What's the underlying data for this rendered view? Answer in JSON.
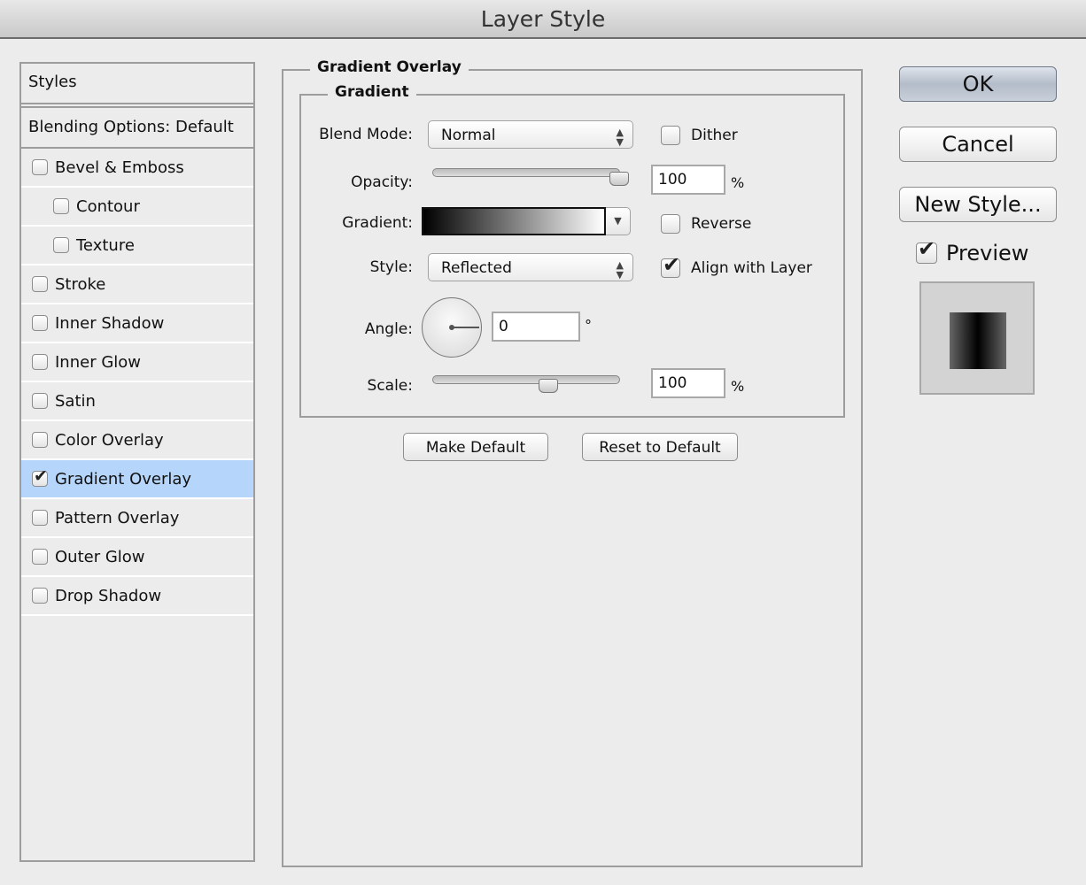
{
  "window": {
    "title": "Layer Style"
  },
  "sidebar": {
    "header": "Styles",
    "blending_options": "Blending Options: Default",
    "items": [
      {
        "label": "Bevel & Emboss",
        "checked": false,
        "indent": false,
        "selected": false
      },
      {
        "label": "Contour",
        "checked": false,
        "indent": true,
        "selected": false
      },
      {
        "label": "Texture",
        "checked": false,
        "indent": true,
        "selected": false
      },
      {
        "label": "Stroke",
        "checked": false,
        "indent": false,
        "selected": false
      },
      {
        "label": "Inner Shadow",
        "checked": false,
        "indent": false,
        "selected": false
      },
      {
        "label": "Inner Glow",
        "checked": false,
        "indent": false,
        "selected": false
      },
      {
        "label": "Satin",
        "checked": false,
        "indent": false,
        "selected": false
      },
      {
        "label": "Color Overlay",
        "checked": false,
        "indent": false,
        "selected": false
      },
      {
        "label": "Gradient Overlay",
        "checked": true,
        "indent": false,
        "selected": true
      },
      {
        "label": "Pattern Overlay",
        "checked": false,
        "indent": false,
        "selected": false
      },
      {
        "label": "Outer Glow",
        "checked": false,
        "indent": false,
        "selected": false
      },
      {
        "label": "Drop Shadow",
        "checked": false,
        "indent": false,
        "selected": false
      }
    ]
  },
  "panel": {
    "title": "Gradient Overlay",
    "group_title": "Gradient",
    "blend_mode": {
      "label": "Blend Mode:",
      "value": "Normal"
    },
    "dither": {
      "label": "Dither",
      "checked": false
    },
    "opacity": {
      "label": "Opacity:",
      "value": "100",
      "unit": "%",
      "slider_percent": 100
    },
    "gradient": {
      "label": "Gradient:",
      "from_color": "#000000",
      "to_color": "#ffffff"
    },
    "reverse": {
      "label": "Reverse",
      "checked": false
    },
    "style": {
      "label": "Style:",
      "value": "Reflected"
    },
    "align_with_layer": {
      "label": "Align with Layer",
      "checked": true
    },
    "angle": {
      "label": "Angle:",
      "value": "0",
      "unit": "°"
    },
    "scale": {
      "label": "Scale:",
      "value": "100",
      "unit": "%",
      "slider_fraction": 0.62
    },
    "make_default": "Make Default",
    "reset_default": "Reset to Default"
  },
  "actions": {
    "ok": "OK",
    "cancel": "Cancel",
    "new_style": "New Style...",
    "preview": {
      "label": "Preview",
      "checked": true
    }
  },
  "colors": {
    "selection": "#b6d5fb",
    "background": "#ececec"
  }
}
